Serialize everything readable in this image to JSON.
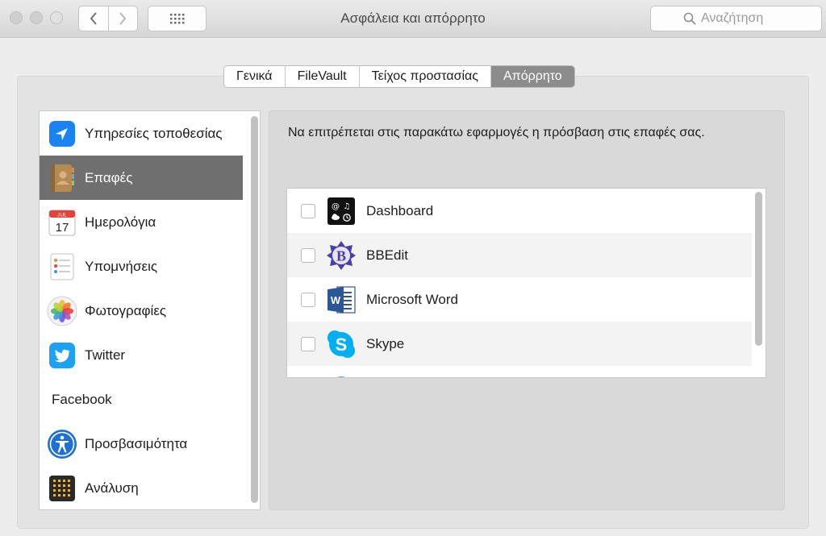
{
  "window": {
    "title": "Ασφάλεια και απόρρητο"
  },
  "toolbar": {
    "back_icon": "chevron-left-icon",
    "forward_icon": "chevron-right-icon",
    "grid_icon": "grid-icon",
    "search_placeholder": "Αναζήτηση"
  },
  "tabs": [
    {
      "label": "Γενικά",
      "active": false
    },
    {
      "label": "FileVault",
      "active": false
    },
    {
      "label": "Τείχος προστασίας",
      "active": false
    },
    {
      "label": "Απόρρητο",
      "active": true
    }
  ],
  "sidebar": {
    "items": [
      {
        "label": "Υπηρεσίες τοποθεσίας",
        "icon": "location-arrow-icon",
        "selected": false
      },
      {
        "label": "Επαφές",
        "icon": "contacts-book-icon",
        "selected": true
      },
      {
        "label": "Ημερολόγια",
        "icon": "calendar-icon",
        "selected": false,
        "icon_text_month": "JUL",
        "icon_text_day": "17"
      },
      {
        "label": "Υπομνήσεις",
        "icon": "reminders-icon",
        "selected": false
      },
      {
        "label": "Φωτογραφίες",
        "icon": "photos-icon",
        "selected": false
      },
      {
        "label": "Twitter",
        "icon": "twitter-icon",
        "selected": false
      },
      {
        "label": "Facebook",
        "icon": "",
        "selected": false
      },
      {
        "label": "Προσβασιμότητα",
        "icon": "accessibility-icon",
        "selected": false
      },
      {
        "label": "Ανάλυση",
        "icon": "analytics-icon",
        "selected": false
      }
    ]
  },
  "panel": {
    "description": "Να επιτρέπεται στις παρακάτω εφαρμογές η πρόσβαση στις επαφές σας."
  },
  "apps": [
    {
      "label": "Dashboard",
      "icon": "dashboard-icon",
      "checked": false
    },
    {
      "label": "BBEdit",
      "icon": "bbedit-icon",
      "checked": false,
      "icon_text": "B"
    },
    {
      "label": "Microsoft Word",
      "icon": "word-icon",
      "checked": false,
      "icon_text": "W"
    },
    {
      "label": "Skype",
      "icon": "skype-icon",
      "checked": false,
      "icon_text": "S"
    },
    {
      "label": "",
      "icon": "skype-partial-icon",
      "checked": false
    }
  ],
  "colors": {
    "selection": "#6f6f6f",
    "tab_active": "#8c8c8c",
    "location_blue": "#1a82f2",
    "twitter_blue": "#1da1f2",
    "skype_blue": "#00aff0",
    "word_blue": "#2b5797"
  }
}
